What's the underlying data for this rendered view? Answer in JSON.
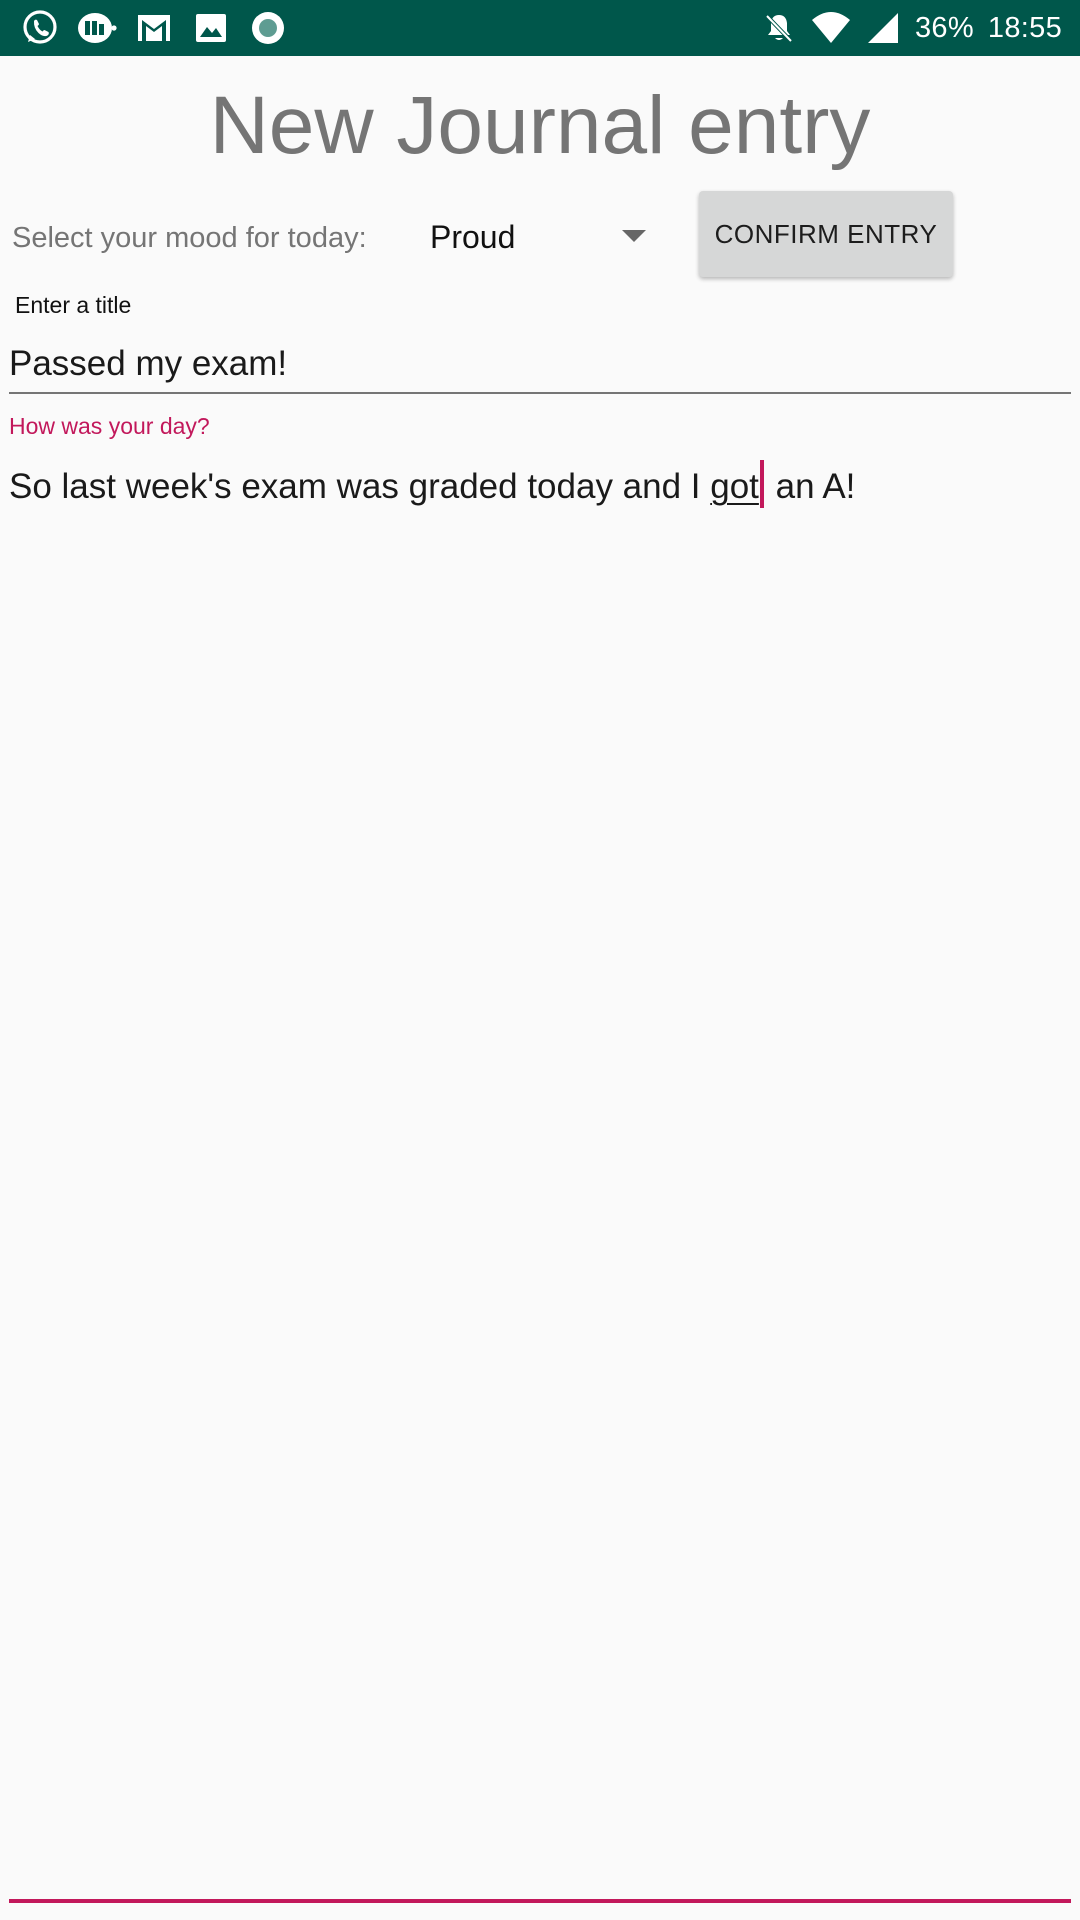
{
  "status_bar": {
    "left_icons": [
      "whatsapp-icon",
      "nfc-pay-icon",
      "gmail-icon",
      "gallery-icon",
      "camera-record-icon"
    ],
    "right_icons": [
      "notifications-off-icon",
      "wifi-icon",
      "cell-signal-icon"
    ],
    "battery": "36%",
    "time": "18:55",
    "background_color": "#00574b"
  },
  "header": {
    "title": "New Journal entry"
  },
  "mood": {
    "label": "Select your mood for today:",
    "selected": "Proud"
  },
  "confirm_button": {
    "label": "CONFIRM ENTRY"
  },
  "title_field": {
    "label": "Enter a title",
    "value": "Passed my exam!"
  },
  "day_field": {
    "label": "How was your day?",
    "text_before": "So last week's exam was graded today and I ",
    "composing_word": "got",
    "text_after": " an A!",
    "accent_color": "#c2185b"
  }
}
